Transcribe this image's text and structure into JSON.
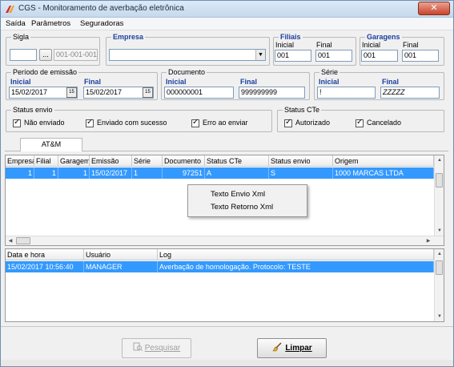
{
  "window": {
    "title": "CGS - Monitoramento de averbação eletrônica",
    "close_label": "✕",
    "colors": {
      "selection": "#3399ff",
      "label_blue": "#1a3f9e"
    }
  },
  "menu": [
    {
      "label": "Saída"
    },
    {
      "label": "Parâmetros"
    },
    {
      "label": "Seguradoras"
    }
  ],
  "filters": {
    "sigla": {
      "legend": "Sigla",
      "value": "",
      "button_label": "...",
      "code_value": "001-001-001"
    },
    "empresa": {
      "legend": "Empresa",
      "value": ""
    },
    "filiais": {
      "legend": "Filiais",
      "inicial_label": "Inicial",
      "final_label": "Final",
      "inicial_value": "001",
      "final_value": "001"
    },
    "garagens": {
      "legend": "Garagens",
      "inicial_label": "Inicial",
      "final_label": "Final",
      "inicial_value": "001",
      "final_value": "001"
    },
    "periodo": {
      "legend": "Período de emissão",
      "inicial_label": "Inicial",
      "final_label": "Final",
      "inicial_value": "15/02/2017",
      "final_value": "15/02/2017",
      "calendar_label": "15"
    },
    "documento": {
      "legend": "Documento",
      "inicial_label": "Inicial",
      "final_label": "Final",
      "inicial_value": "000000001",
      "final_value": "999999999"
    },
    "serie": {
      "legend": "Série",
      "inicial_label": "Inicial",
      "final_label": "Final",
      "inicial_value": "!",
      "final_value": "ZZZZZ"
    },
    "status_envio": {
      "legend": "Status envio",
      "options": [
        {
          "label": "Não enviado",
          "checked": true
        },
        {
          "label": "Enviado com sucesso",
          "checked": true
        },
        {
          "label": "Erro ao enviar",
          "checked": true
        }
      ]
    },
    "status_cte": {
      "legend": "Status CTe",
      "options": [
        {
          "label": "Autorizado",
          "checked": true
        },
        {
          "label": "Cancelado",
          "checked": true
        }
      ]
    }
  },
  "tab": {
    "label": "AT&M"
  },
  "main_grid": {
    "columns": [
      "Empresa",
      "Filial",
      "Garagem",
      "Emissão",
      "Série",
      "Documento",
      "Status CTe",
      "Status envio",
      "Origem"
    ],
    "rows": [
      {
        "empresa": "1",
        "filial": "1",
        "garagem": "1",
        "emissao": "15/02/2017",
        "serie": "1",
        "documento": "97251",
        "status_cte": "A",
        "status_envio": "S",
        "origem": "1000 MARCAS LTDA"
      }
    ]
  },
  "context_menu": {
    "items": [
      {
        "label": "Texto Envio Xml"
      },
      {
        "label": "Texto Retorno Xml"
      }
    ]
  },
  "log_grid": {
    "columns": [
      "Data e hora",
      "Usuário",
      "Log"
    ],
    "rows": [
      {
        "data_hora": "15/02/2017 10:56:40",
        "usuario": "MANAGER",
        "log": "Averbação de homologação. Protocolo: TESTE"
      }
    ]
  },
  "buttons": {
    "pesquisar": {
      "label": "Pesquisar",
      "enabled": false
    },
    "limpar": {
      "label": "Limpar",
      "enabled": true
    }
  }
}
